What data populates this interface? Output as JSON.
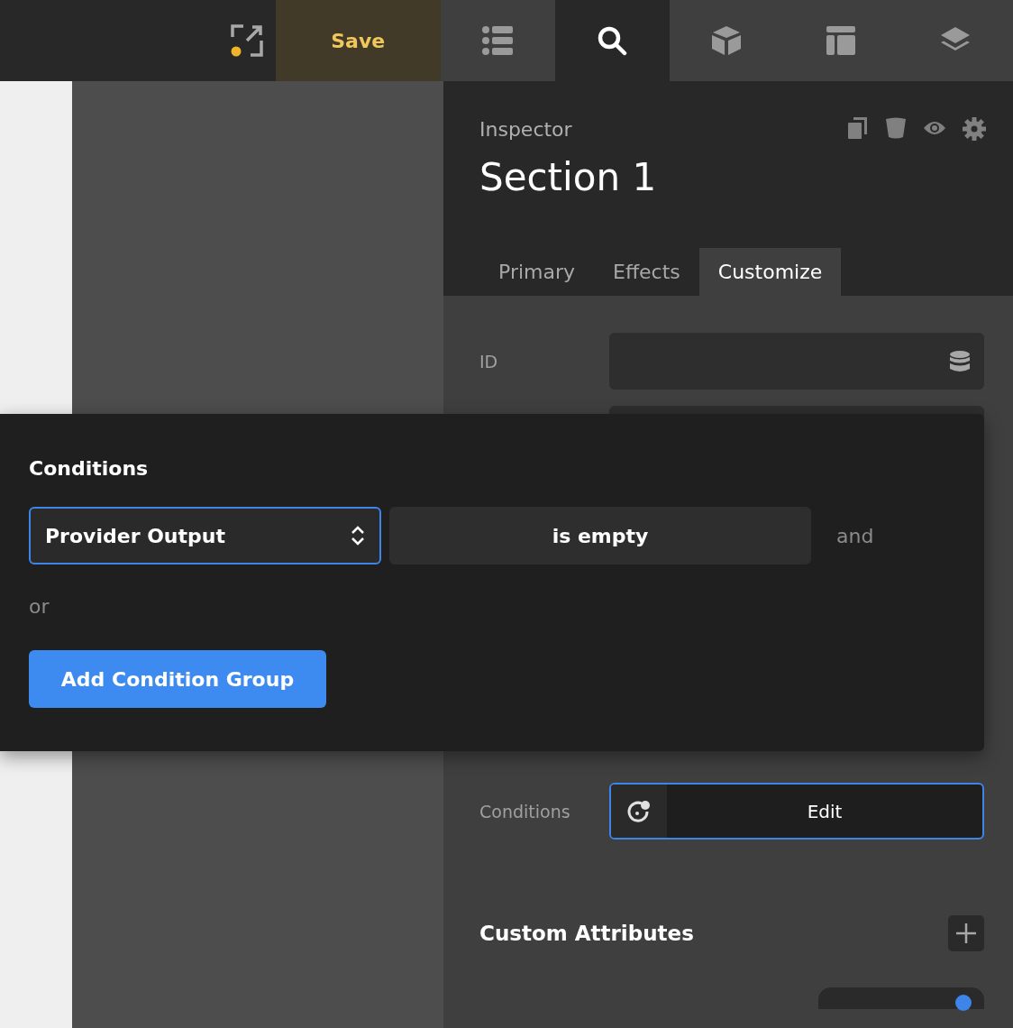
{
  "toolbar": {
    "save_label": "Save",
    "unsaved": true,
    "tabs": [
      {
        "kind": "list",
        "selected": false
      },
      {
        "kind": "search",
        "selected": true
      },
      {
        "kind": "cube",
        "selected": false
      },
      {
        "kind": "layout",
        "selected": false
      },
      {
        "kind": "layers",
        "selected": false
      }
    ]
  },
  "inspector": {
    "label": "Inspector",
    "title": "Section 1",
    "tabs": [
      {
        "label": "Primary",
        "selected": false
      },
      {
        "label": "Effects",
        "selected": false
      },
      {
        "label": "Customize",
        "selected": true
      }
    ],
    "id_field": {
      "label": "ID"
    },
    "conditions_field": {
      "label": "Conditions",
      "button": "Edit"
    },
    "custom_attributes": {
      "title": "Custom Attributes"
    }
  },
  "conditions_popup": {
    "title": "Conditions",
    "rows": [
      {
        "field": "Provider Output",
        "operator": "is empty",
        "joiner": "and"
      }
    ],
    "or_label": "or",
    "add_button": "Add Condition Group"
  }
}
